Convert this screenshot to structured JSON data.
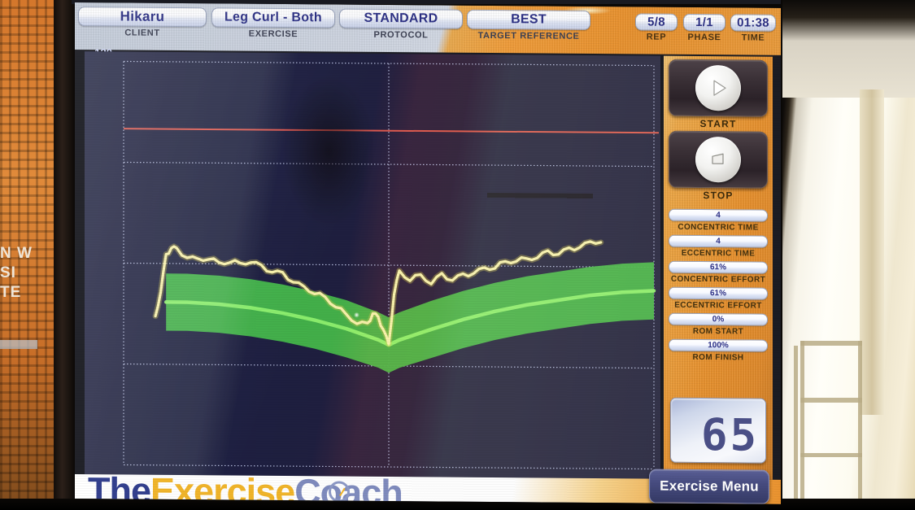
{
  "header": {
    "fields": [
      {
        "value": "Hikaru",
        "label": "CLIENT"
      },
      {
        "value": "Leg Curl - Both",
        "label": "EXERCISE"
      },
      {
        "value": "STANDARD",
        "label": "PROTOCOL"
      },
      {
        "value": "BEST",
        "label": "TARGET REFERENCE"
      }
    ],
    "counters": [
      {
        "value": "5/8",
        "label": "REP"
      },
      {
        "value": "1/1",
        "label": "PHASE"
      },
      {
        "value": "01:38",
        "label": "TIME"
      }
    ]
  },
  "controls": {
    "start": {
      "label": "START",
      "icon": "play-icon"
    },
    "stop": {
      "label": "STOP",
      "icon": "stop-icon"
    }
  },
  "stats": [
    {
      "value": "4",
      "label": "CONCENTRIC TIME"
    },
    {
      "value": "4",
      "label": "ECCENTRIC TIME"
    },
    {
      "value": "61%",
      "label": "CONCENTRIC EFFORT"
    },
    {
      "value": "61%",
      "label": "ECCENTRIC EFFORT"
    },
    {
      "value": "0%",
      "label": "ROM START"
    },
    {
      "value": "100%",
      "label": "ROM FINISH"
    }
  ],
  "readout": {
    "value": "65"
  },
  "footer": {
    "logo_the": "The",
    "logo_exercise": "Exercise",
    "logo_coach": "Coach",
    "exercise_menu": "Exercise Menu"
  },
  "background": {
    "sign_text": "N W\nSI\nTE"
  },
  "colors": {
    "accent_orange": "#e8922f",
    "plot_background": "#181b3a",
    "target_band": "#3eb345",
    "target_center": "#8bf06a",
    "trace": "#f7f0a8",
    "limit_line": "#ef5b4c",
    "pill_text": "#2b2f85"
  },
  "chart_data": {
    "type": "line",
    "title": "",
    "xlabel": "",
    "ylabel": "",
    "ylim": [
      0,
      120
    ],
    "xlim": [
      0,
      100
    ],
    "yticks": [
      120,
      90,
      60,
      30,
      0
    ],
    "grid": true,
    "gridlines_y": [
      120,
      90,
      60,
      30,
      0
    ],
    "gridlines_x": [
      0,
      50,
      100
    ],
    "annotations": [
      {
        "name": "limit-line",
        "type": "hline",
        "y": 100,
        "color": "#ef5b4c"
      }
    ],
    "series": [
      {
        "name": "Target band upper",
        "type": "area-upper",
        "color": "#3eb345",
        "x": [
          8,
          12,
          18,
          24,
          30,
          36,
          42,
          48,
          50,
          52,
          58,
          64,
          70,
          76,
          82,
          88,
          94,
          100
        ],
        "y": [
          57,
          57,
          56.5,
          55.5,
          54,
          52,
          49.5,
          46,
          44.5,
          46,
          49.5,
          52.5,
          55,
          57,
          58.5,
          60,
          61,
          61.5
        ]
      },
      {
        "name": "Target band lower",
        "type": "area-lower",
        "color": "#3eb345",
        "x": [
          8,
          12,
          18,
          24,
          30,
          36,
          42,
          48,
          50,
          52,
          58,
          64,
          70,
          76,
          82,
          88,
          94,
          100
        ],
        "y": [
          40,
          40,
          39.5,
          38.5,
          37,
          35,
          32.5,
          29.5,
          28,
          29.5,
          32.5,
          35.5,
          38,
          40,
          41.5,
          43,
          44,
          44.5
        ]
      },
      {
        "name": "Target center",
        "type": "line",
        "color": "#8bf06a",
        "x": [
          8,
          12,
          18,
          24,
          30,
          36,
          42,
          48,
          50,
          52,
          58,
          64,
          70,
          76,
          82,
          88,
          94,
          100
        ],
        "y": [
          48.5,
          48.5,
          48,
          47,
          45.5,
          43.5,
          41,
          37.8,
          36.3,
          37.8,
          41,
          44,
          46.5,
          48.5,
          50,
          51.5,
          52.5,
          53
        ]
      },
      {
        "name": "Force trace",
        "type": "line",
        "color": "#f7f0a8",
        "x": [
          6,
          7,
          8,
          9,
          10,
          12,
          14,
          16,
          18,
          20,
          22,
          24,
          26,
          28,
          30,
          32,
          34,
          36,
          38,
          40,
          42,
          44,
          46,
          47,
          48,
          49,
          50,
          51,
          52,
          54,
          56,
          58,
          60,
          62,
          64,
          66,
          68,
          70,
          72,
          74,
          76,
          78,
          80,
          82,
          84,
          86,
          88,
          90
        ],
        "y": [
          44,
          52,
          62,
          65,
          64,
          62,
          61,
          62,
          60,
          61,
          60,
          61,
          59,
          58,
          57,
          55,
          53,
          52,
          50,
          48,
          45,
          43,
          42,
          46,
          44,
          41,
          36,
          52,
          58,
          56,
          57,
          55,
          57,
          56,
          57,
          58,
          59,
          60,
          61,
          62,
          62,
          63,
          64,
          64,
          65,
          66,
          67,
          68
        ]
      }
    ]
  }
}
